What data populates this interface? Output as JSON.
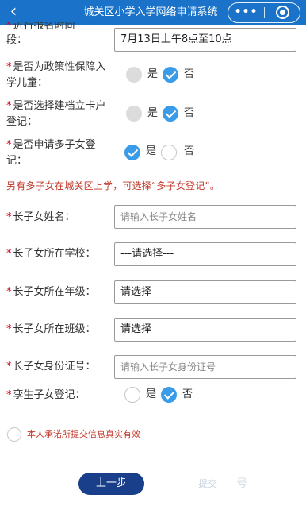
{
  "header": {
    "back_glyph": "‹",
    "title": "城关区小学入学网络申请系统",
    "more_glyph": "•••",
    "bg_color": "#1a73c8"
  },
  "form": {
    "time_row": {
      "label_cut": "进行报名时间",
      "label_end": "段：",
      "value": "7月13日上午8点至10点"
    },
    "policy_row": {
      "req": "*",
      "label_1": "是否为政策性保障入",
      "label_2": "学儿童：",
      "yes": "是",
      "no": "否"
    },
    "file_row": {
      "req": "*",
      "label_1": "是否选择建档立卡户",
      "label_2": "登记：",
      "yes": "是",
      "no": "否"
    },
    "multi_row": {
      "req": "*",
      "label_1": "是否申请多子女登",
      "label_2": "记：",
      "yes": "是",
      "no": "否"
    },
    "notice": "另有多子女在城关区上学，可选择“多子女登记”。",
    "elder_name": {
      "req": "*",
      "label": "长子女姓名：",
      "placeholder": "请输入长子女姓名"
    },
    "elder_school": {
      "req": "*",
      "label": "长子女所在学校：",
      "value": "---请选择---"
    },
    "elder_grade": {
      "req": "*",
      "label": "长子女所在年级：",
      "value": "请选择"
    },
    "elder_class": {
      "req": "*",
      "label": "长子女所在班级：",
      "value": "请选择"
    },
    "elder_id": {
      "req": "*",
      "label": "长子女身份证号：",
      "placeholder": "请输入长子女身份证号"
    },
    "twin_row": {
      "req": "*",
      "label": "孪生子女登记：",
      "yes": "是",
      "no": "否"
    }
  },
  "agreement": {
    "text": "本人承诺所提交信息真实有效"
  },
  "footer": {
    "prev_label": "上一步",
    "submit_label": "提交",
    "watermark": "号"
  },
  "colors": {
    "accent": "#3a9be8",
    "required": "#d0021b",
    "notice": "#c0392b",
    "prev_button": "#1a3f8a"
  }
}
